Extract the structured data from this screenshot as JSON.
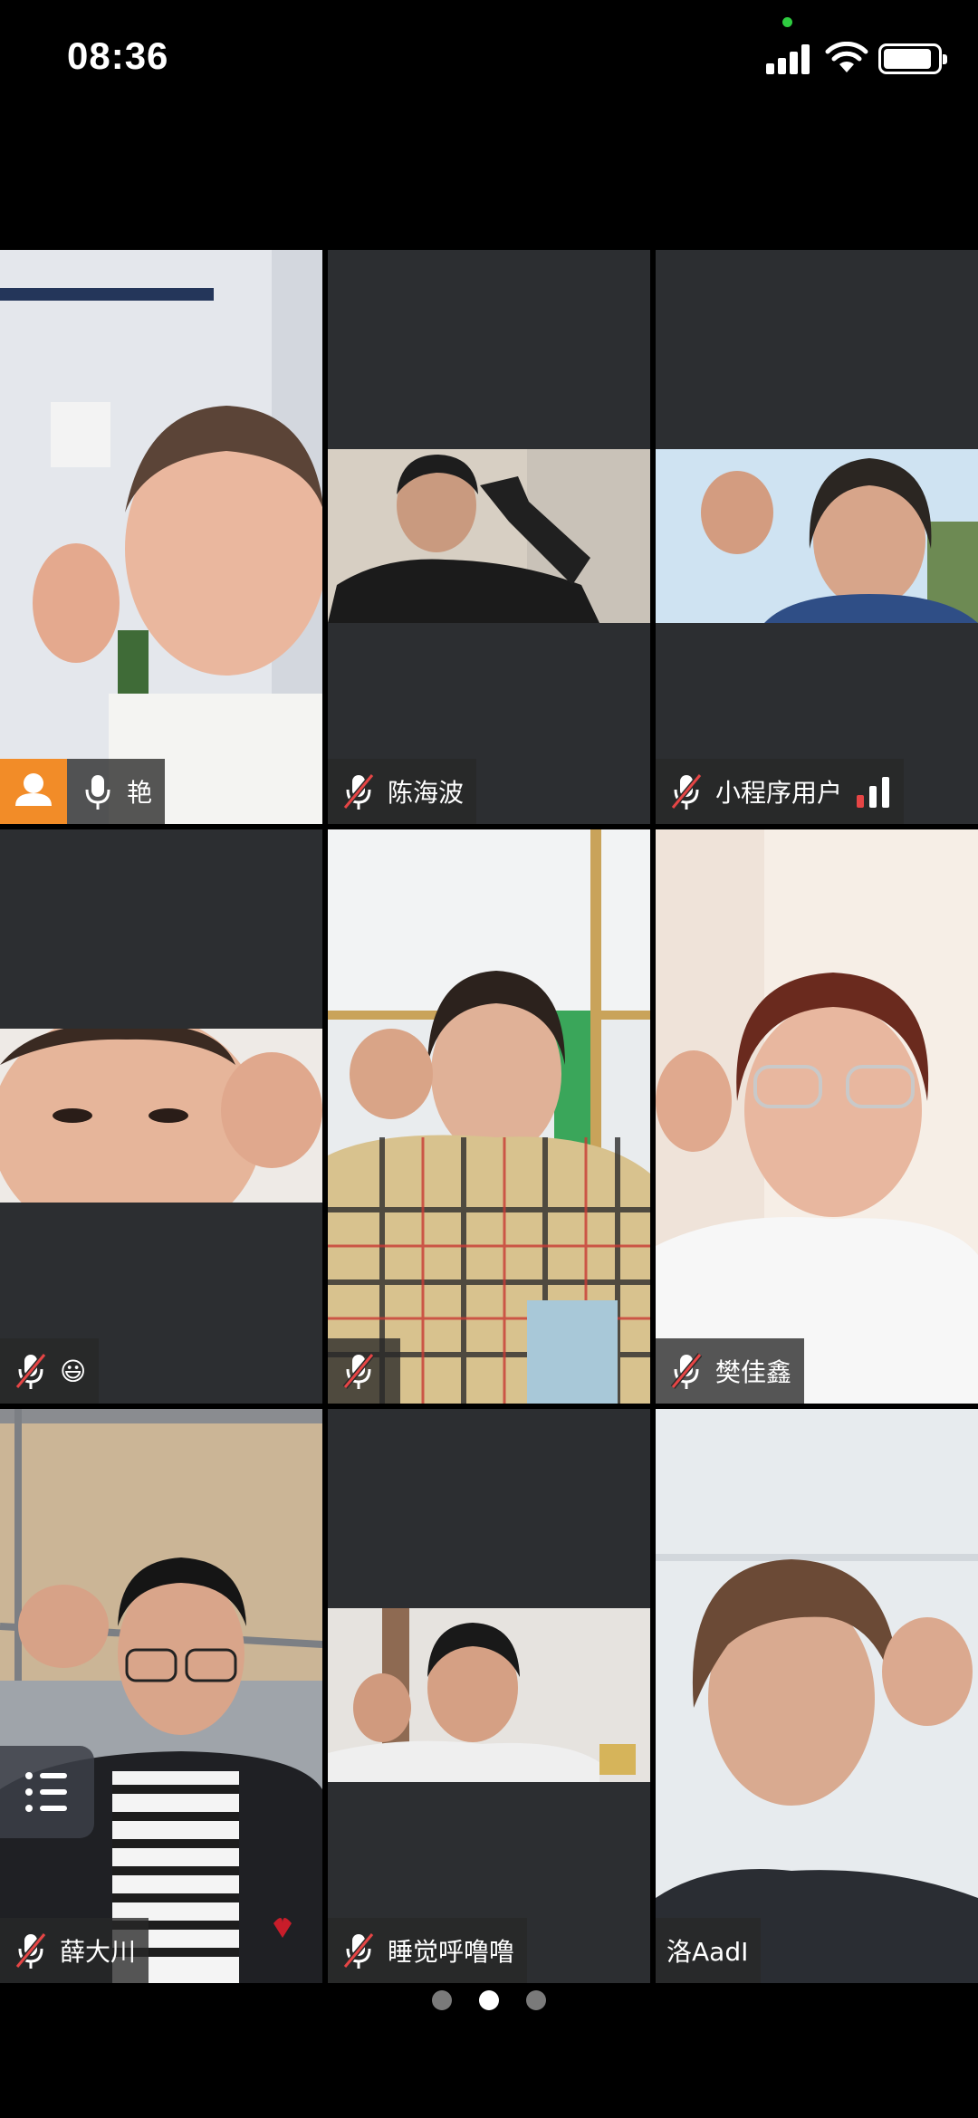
{
  "status_bar": {
    "time": "08:36"
  },
  "participants": [
    {
      "name": "艳",
      "muted": false,
      "host": true
    },
    {
      "name": "陈海波",
      "muted": true,
      "host": false
    },
    {
      "name": "小程序用户",
      "muted": true,
      "host": false,
      "signal": "weak"
    },
    {
      "name": "😃",
      "muted": true,
      "host": false
    },
    {
      "name": "",
      "muted": true,
      "host": false
    },
    {
      "name": "樊佳鑫",
      "muted": true,
      "host": false
    },
    {
      "name": "薛大川",
      "muted": true,
      "host": false
    },
    {
      "name": "睡觉呼噜噜",
      "muted": true,
      "host": false
    },
    {
      "name": "洛AadI",
      "muted": false,
      "host": false
    }
  ],
  "pagination": {
    "pages": 3,
    "current": 2
  },
  "colors": {
    "host_badge": "#f28c28",
    "tile_bg": "#2c2e31",
    "mute_slash": "#e64545"
  },
  "icons": [
    "person-icon",
    "microphone-icon",
    "microphone-muted-icon",
    "signal-icon",
    "wifi-icon",
    "battery-icon",
    "list-icon"
  ]
}
